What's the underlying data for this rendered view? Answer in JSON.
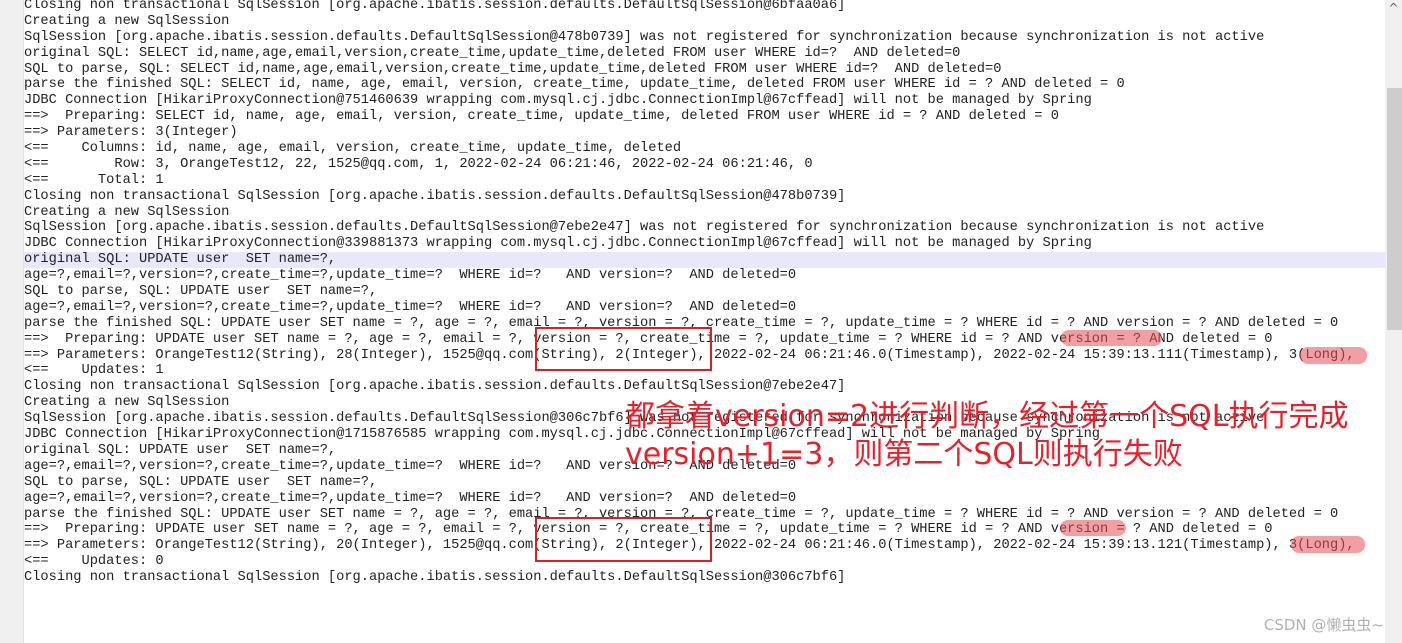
{
  "console": {
    "lines": [
      "Closing non transactional SqlSession [org.apache.ibatis.session.defaults.DefaultSqlSession@6bfaa0a6]",
      "Creating a new SqlSession",
      "SqlSession [org.apache.ibatis.session.defaults.DefaultSqlSession@478b0739] was not registered for synchronization because synchronization is not active",
      "original SQL: SELECT id,name,age,email,version,create_time,update_time,deleted FROM user WHERE id=?  AND deleted=0",
      "SQL to parse, SQL: SELECT id,name,age,email,version,create_time,update_time,deleted FROM user WHERE id=?  AND deleted=0",
      "parse the finished SQL: SELECT id, name, age, email, version, create_time, update_time, deleted FROM user WHERE id = ? AND deleted = 0",
      "JDBC Connection [HikariProxyConnection@751460639 wrapping com.mysql.cj.jdbc.ConnectionImpl@67cffead] will not be managed by Spring",
      "==>  Preparing: SELECT id, name, age, email, version, create_time, update_time, deleted FROM user WHERE id = ? AND deleted = 0",
      "==> Parameters: 3(Integer)",
      "<==    Columns: id, name, age, email, version, create_time, update_time, deleted",
      "<==        Row: 3, OrangeTest12, 22, 1525@qq.com, 1, 2022-02-24 06:21:46, 2022-02-24 06:21:46, 0",
      "<==      Total: 1",
      "Closing non transactional SqlSession [org.apache.ibatis.session.defaults.DefaultSqlSession@478b0739]",
      "Creating a new SqlSession",
      "SqlSession [org.apache.ibatis.session.defaults.DefaultSqlSession@7ebe2e47] was not registered for synchronization because synchronization is not active",
      "JDBC Connection [HikariProxyConnection@339881373 wrapping com.mysql.cj.jdbc.ConnectionImpl@67cffead] will not be managed by Spring",
      "original SQL: UPDATE user  SET name=?,",
      "age=?,email=?,version=?,create_time=?,update_time=?  WHERE id=?   AND version=?  AND deleted=0",
      "SQL to parse, SQL: UPDATE user  SET name=?,",
      "age=?,email=?,version=?,create_time=?,update_time=?  WHERE id=?   AND version=?  AND deleted=0",
      "parse the finished SQL: UPDATE user SET name = ?, age = ?, email = ?, version = ?, create_time = ?, update_time = ? WHERE id = ? AND version = ? AND deleted = 0",
      "==>  Preparing: UPDATE user SET name = ?, age = ?, email = ?, version = ?, create_time = ?, update_time = ? WHERE id = ? AND version = ? AND deleted = 0",
      "==> Parameters: OrangeTest12(String), 28(Integer), 1525@qq.com(String), 2(Integer), 2022-02-24 06:21:46.0(Timestamp), 2022-02-24 15:39:13.111(Timestamp), 3(Long),",
      "<==    Updates: 1",
      "Closing non transactional SqlSession [org.apache.ibatis.session.defaults.DefaultSqlSession@7ebe2e47]",
      "Creating a new SqlSession",
      "SqlSession [org.apache.ibatis.session.defaults.DefaultSqlSession@306c7bf6] was not registered for synchronization because synchronization is not active",
      "JDBC Connection [HikariProxyConnection@1715876585 wrapping com.mysql.cj.jdbc.ConnectionImpl@67cffead] will not be managed by Spring",
      "original SQL: UPDATE user  SET name=?,",
      "age=?,email=?,version=?,create_time=?,update_time=?  WHERE id=?   AND version=?  AND deleted=0",
      "SQL to parse, SQL: UPDATE user  SET name=?,",
      "age=?,email=?,version=?,create_time=?,update_time=?  WHERE id=?   AND version=?  AND deleted=0",
      "parse the finished SQL: UPDATE user SET name = ?, age = ?, email = ?, version = ?, create_time = ?, update_time = ? WHERE id = ? AND version = ? AND deleted = 0",
      "==>  Preparing: UPDATE user SET name = ?, age = ?, email = ?, version = ?, create_time = ?, update_time = ? WHERE id = ? AND version = ? AND deleted = 0",
      "==> Parameters: OrangeTest12(String), 20(Integer), 1525@qq.com(String), 2(Integer), 2022-02-24 06:21:46.0(Timestamp), 2022-02-24 15:39:13.121(Timestamp), 3(Long),",
      "<==    Updates: 0",
      "Closing non transactional SqlSession [org.apache.ibatis.session.defaults.DefaultSqlSession@306c7bf6]"
    ],
    "highlighted_line": 16
  },
  "annotation": {
    "line1": "都拿着version=2进行判断，经过第一个SQL执行完成",
    "line2": "version+1=3，则第二个SQL则执行失败",
    "color": "#e8202a"
  },
  "watermark": "CSDN @懒虫虫~",
  "scrollbar": {
    "up_icon": "^",
    "position_fraction": 0.14
  }
}
